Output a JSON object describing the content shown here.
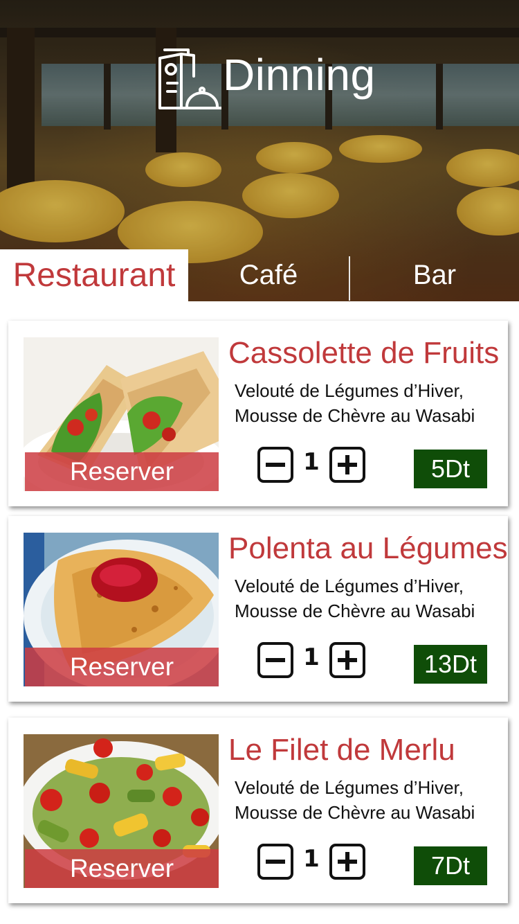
{
  "header": {
    "title": "Dinning",
    "logo_icon": "menu-cloche-icon"
  },
  "tabs": [
    {
      "label": "Restaurant",
      "active": true
    },
    {
      "label": "Café",
      "active": false
    },
    {
      "label": "Bar",
      "active": false
    }
  ],
  "colors": {
    "accent_red": "#c0393b",
    "reserve_bg": "#cd3c42",
    "price_bg": "#0f4d08"
  },
  "items": [
    {
      "name": "Cassolette de Fruits",
      "desc_line1": "Velouté de Légumes d’Hiver,",
      "desc_line2": "Mousse de Chèvre au Wasabi",
      "reserve_label": "Reserver",
      "quantity": "1",
      "price": "5Dt",
      "photo": "wrap-sandwich-photo"
    },
    {
      "name": "Polenta au Légumes",
      "desc_line1": "Velouté de Légumes d’Hiver,",
      "desc_line2": "Mousse de Chèvre au Wasabi",
      "reserve_label": "Reserver",
      "quantity": "1",
      "price": "13Dt",
      "photo": "crepe-with-jam-photo"
    },
    {
      "name": "Le Filet de Merlu",
      "desc_line1": "Velouté de Légumes d’Hiver,",
      "desc_line2": "Mousse de Chèvre au Wasabi",
      "reserve_label": "Reserver",
      "quantity": "1",
      "price": "7Dt",
      "photo": "grilled-vegetables-photo"
    }
  ]
}
